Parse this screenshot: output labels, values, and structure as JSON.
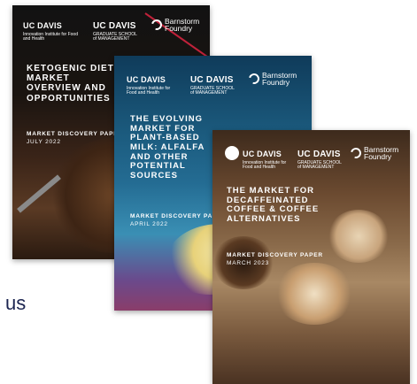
{
  "covers": [
    {
      "logos": {
        "ucd_main": "UC DAVIS",
        "ucd_sub": "Innovation Institute for Food and Health",
        "gsm_main": "UC DAVIS",
        "gsm_sub": "GRADUATE SCHOOL of MANAGEMENT",
        "bf_line1": "Barnstorm",
        "bf_line2": "Foundry"
      },
      "title": "KETOGENIC DIET MARKET OVERVIEW AND OPPORTUNITIES",
      "paper_type": "MARKET DISCOVERY PAPER",
      "date": "JULY 2022"
    },
    {
      "logos": {
        "ucd_main": "UC DAVIS",
        "ucd_sub": "Innovation Institute for Food and Health",
        "gsm_main": "UC DAVIS",
        "gsm_sub": "GRADUATE SCHOOL of MANAGEMENT",
        "bf_line1": "Barnstorm",
        "bf_line2": "Foundry"
      },
      "title": "THE EVOLVING MARKET FOR PLANT-BASED MILK: ALFALFA AND OTHER POTENTIAL SOURCES",
      "paper_type": "MARKET DISCOVERY PAPER",
      "date": "APRIL 2022"
    },
    {
      "logos": {
        "ucd_main": "UC DAVIS",
        "ucd_sub": "Innovation Institute for Food and Health",
        "gsm_main": "UC DAVIS",
        "gsm_sub": "GRADUATE SCHOOL of MANAGEMENT",
        "bf_line1": "Barnstorm",
        "bf_line2": "Foundry"
      },
      "title": "THE MARKET FOR DECAFFEINATED COFFEE & COFFEE ALTERNATIVES",
      "paper_type": "MARKET DISCOVERY PAPER",
      "date": "MARCH 2023"
    }
  ],
  "cropped_text": "us"
}
